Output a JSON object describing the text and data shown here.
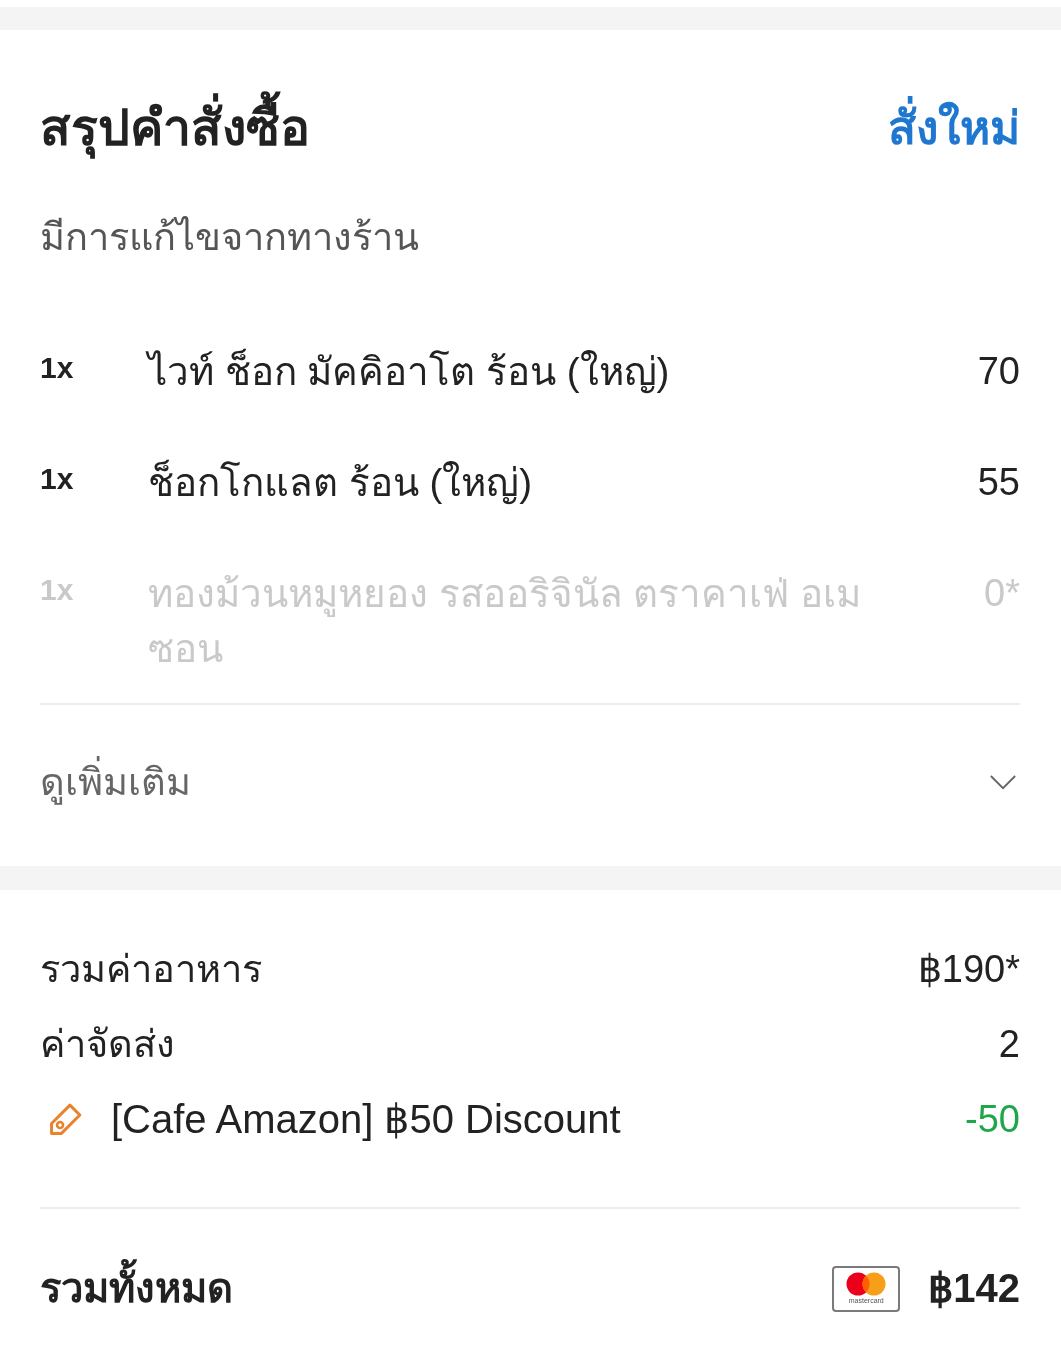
{
  "order_summary": {
    "title": "สรุปคำสั่งซื้อ",
    "reorder_link": "สั่งใหม่",
    "notice": "มีการแก้ไขจากทางร้าน",
    "items": [
      {
        "quantity": "1x",
        "name": "ไวท์ ช็อก มัคคิอาโต ร้อน (ใหญ่)",
        "price": "70",
        "disabled": false
      },
      {
        "quantity": "1x",
        "name": "ช็อกโกแลต ร้อน (ใหญ่)",
        "price": "55",
        "disabled": false
      },
      {
        "quantity": "1x",
        "name": "ทองม้วนหมูหยอง รสออริจินัล ตราคาเฟ่ อเมซอน",
        "price": "0*",
        "disabled": true
      }
    ],
    "see_more": {
      "label": "ดูเพิ่มเติม",
      "expanded": false
    }
  },
  "totals": {
    "lines": [
      {
        "kind": "plain",
        "label": "รวมค่าอาหาร",
        "amount": "฿190*"
      },
      {
        "kind": "plain",
        "label": "ค่าจัดส่ง",
        "amount": "2"
      },
      {
        "kind": "discount",
        "label": "[Cafe Amazon] ฿50 Discount",
        "amount": "-50"
      }
    ],
    "grand_total": {
      "label": "รวมทั้งหมด",
      "card_brand": "mastercard",
      "amount": "฿142"
    }
  }
}
